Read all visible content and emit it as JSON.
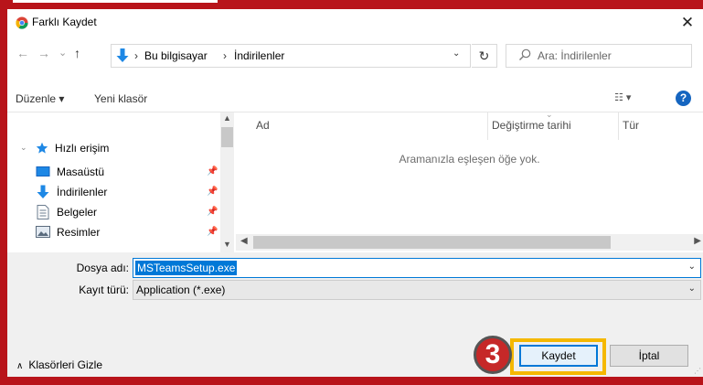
{
  "window": {
    "title": "Farklı Kaydet",
    "close_glyph": "✕"
  },
  "nav": {
    "back_glyph": "←",
    "forward_glyph": "→",
    "recent_glyph": "⌄",
    "up_glyph": "↑"
  },
  "address": {
    "crumbs": [
      "Bu bilgisayar",
      "İndirilenler"
    ],
    "separator": "›",
    "dropdown_glyph": "⌄",
    "refresh_glyph": "↻"
  },
  "search": {
    "placeholder": "Ara: İndirilenler"
  },
  "toolbar": {
    "organize_label": "Düzenle ▾",
    "new_folder_label": "Yeni klasör",
    "view_label": "☷ ▾",
    "help_label": "?"
  },
  "sidebar": {
    "quick_access": "Hızlı erişim",
    "items": [
      {
        "label": "Masaüstü",
        "icon": "desktop-icon"
      },
      {
        "label": "İndirilenler",
        "icon": "download-icon"
      },
      {
        "label": "Belgeler",
        "icon": "documents-icon"
      },
      {
        "label": "Resimler",
        "icon": "pictures-icon"
      }
    ]
  },
  "filelist": {
    "columns": [
      "Ad",
      "Değiştirme tarihi",
      "Tür"
    ],
    "empty_message": "Aramanızla eşleşen öğe yok."
  },
  "form": {
    "filename_label": "Dosya adı:",
    "filename_value": "MSTeamsSetup.exe",
    "filetype_label": "Kayıt türü:",
    "filetype_value": "Application (*.exe)"
  },
  "footer": {
    "hide_folders_label": "Klasörleri Gizle",
    "save_label": "Kaydet",
    "cancel_label": "İptal",
    "step_badge": "3"
  },
  "colors": {
    "accent": "#0078d7",
    "frame": "#b8141a",
    "highlight": "#f5b800",
    "badge": "#c62828"
  }
}
